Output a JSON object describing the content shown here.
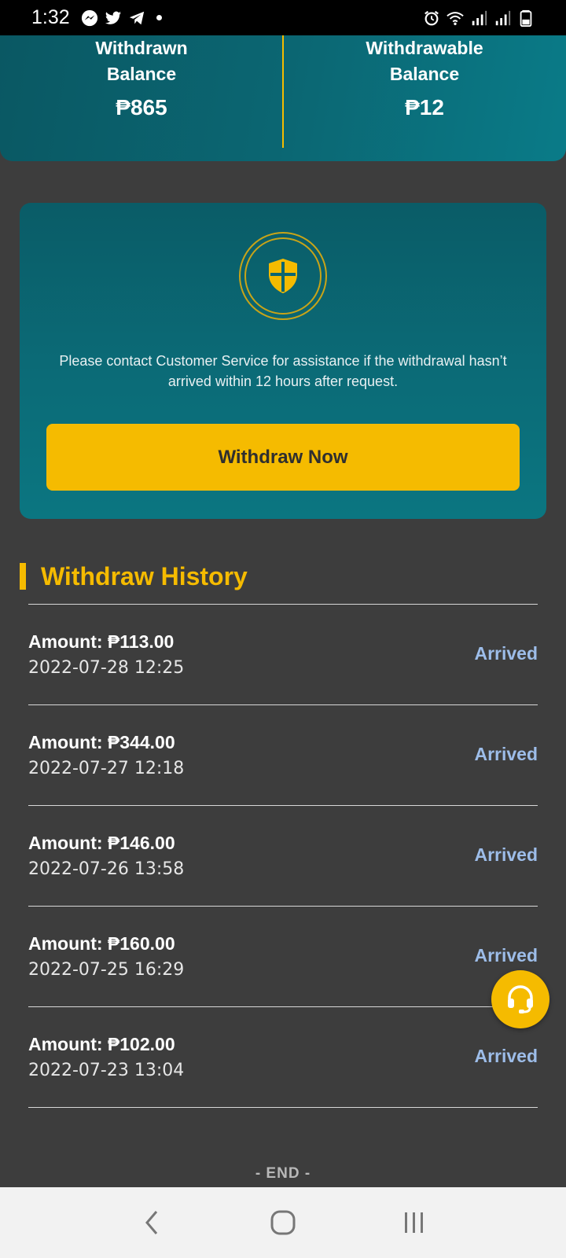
{
  "status_bar": {
    "time": "1:32",
    "left_icons": [
      "messenger-icon",
      "twitter-icon",
      "telegram-icon",
      "dot-icon"
    ],
    "right_icons": [
      "alarm-icon",
      "wifi-icon",
      "signal-icon",
      "signal-icon-2",
      "battery-icon"
    ]
  },
  "balances": {
    "withdrawn": {
      "label": "Withdrawn Balance",
      "value": "₱865"
    },
    "withdrawable": {
      "label": "Withdrawable Balance",
      "value": "₱12"
    }
  },
  "info_card": {
    "icon": "shield-icon",
    "message": "Please contact Customer Service for assistance if the withdrawal hasn’t arrived within 12 hours after request.",
    "button_label": "Withdraw Now"
  },
  "history": {
    "title": "Withdraw History",
    "items": [
      {
        "amount": "Amount: ₱113.00",
        "date": "2022-07-28 12:25",
        "status": "Arrived"
      },
      {
        "amount": "Amount: ₱344.00",
        "date": "2022-07-27 12:18",
        "status": "Arrived"
      },
      {
        "amount": "Amount: ₱146.00",
        "date": "2022-07-26 13:58",
        "status": "Arrived"
      },
      {
        "amount": "Amount: ₱160.00",
        "date": "2022-07-25 16:29",
        "status": "Arrived"
      },
      {
        "amount": "Amount: ₱102.00",
        "date": "2022-07-23 13:04",
        "status": "Arrived"
      }
    ],
    "end_text": "- END -"
  },
  "colors": {
    "accent": "#f5bb00",
    "teal": "#0b6a76",
    "status_arrived": "#9dbde9",
    "background": "#3d3d3d"
  },
  "nav": {
    "icons": [
      "back-icon",
      "home-icon",
      "recents-icon"
    ]
  }
}
